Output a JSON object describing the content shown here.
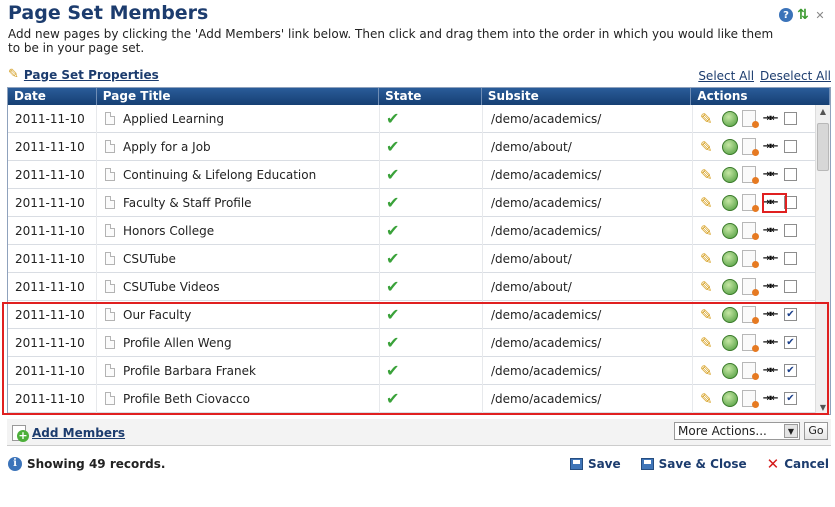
{
  "header": {
    "title": "Page Set Members",
    "description": "Add new pages by clicking the 'Add Members' link below. Then click and drag them into the order in which you would like them to be in your page set.",
    "help_icon": "help-icon",
    "refresh_icon": "refresh-icon",
    "close_icon": "close-icon"
  },
  "props_link": "Page Set Properties",
  "select_all": "Select All",
  "deselect_all": "Deselect All",
  "columns": [
    "Date",
    "Page Title",
    "State",
    "Subsite",
    "Actions"
  ],
  "rows": [
    {
      "date": "2011-11-10",
      "title": "Applied Learning",
      "subsite": "/demo/academics/",
      "checked": false
    },
    {
      "date": "2011-11-10",
      "title": "Apply for a Job",
      "subsite": "/demo/about/",
      "checked": false
    },
    {
      "date": "2011-11-10",
      "title": "Continuing & Lifelong Education",
      "subsite": "/demo/academics/",
      "checked": false
    },
    {
      "date": "2011-11-10",
      "title": "Faculty & Staff Profile",
      "subsite": "/demo/academics/",
      "checked": false
    },
    {
      "date": "2011-11-10",
      "title": "Honors College",
      "subsite": "/demo/academics/",
      "checked": false
    },
    {
      "date": "2011-11-10",
      "title": "CSUTube",
      "subsite": "/demo/about/",
      "checked": false
    },
    {
      "date": "2011-11-10",
      "title": "CSUTube Videos",
      "subsite": "/demo/about/",
      "checked": false
    },
    {
      "date": "2011-11-10",
      "title": "Our Faculty",
      "subsite": "/demo/academics/",
      "checked": true
    },
    {
      "date": "2011-11-10",
      "title": "Profile Allen Weng",
      "subsite": "/demo/academics/",
      "checked": true
    },
    {
      "date": "2011-11-10",
      "title": "Profile Barbara Franek",
      "subsite": "/demo/academics/",
      "checked": true
    },
    {
      "date": "2011-11-10",
      "title": "Profile Beth Ciovacco",
      "subsite": "/demo/academics/",
      "checked": true
    }
  ],
  "footer": {
    "add_members": "Add Members",
    "more_actions": "More Actions...",
    "go": "Go"
  },
  "records": "Showing 49 records.",
  "buttons": {
    "save": "Save",
    "save_close": "Save & Close",
    "cancel": "Cancel"
  },
  "colors": {
    "header_blue": "#1c3c6e",
    "grid_header": "#163f73",
    "highlight": "#e02020"
  }
}
